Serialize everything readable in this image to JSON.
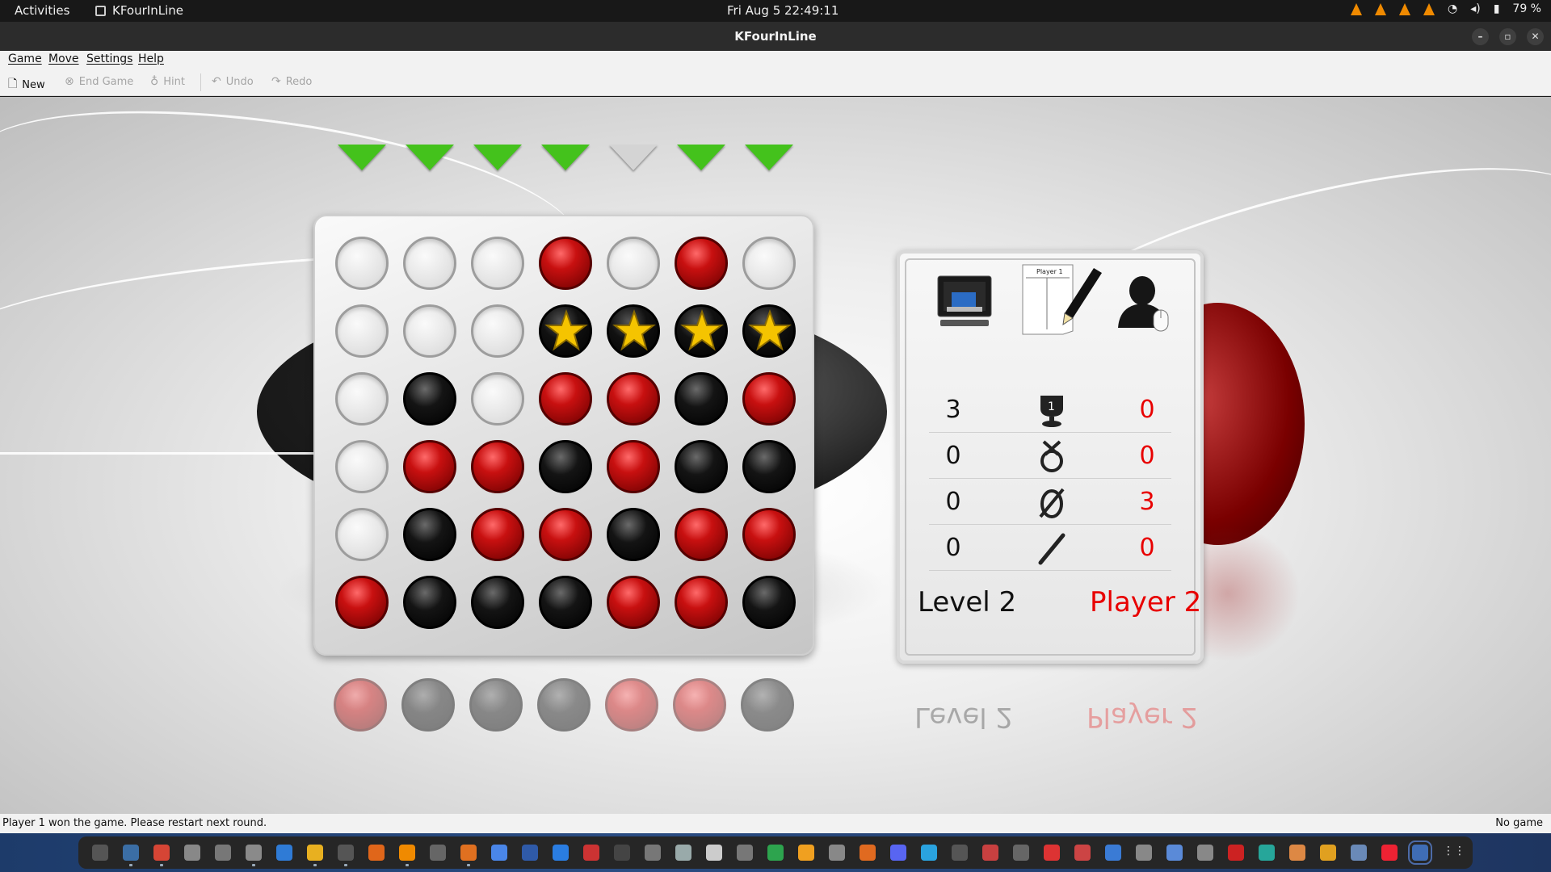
{
  "topbar": {
    "activities": "Activities",
    "app_name": "KFourInLine",
    "clock": "Fri Aug 5  22:49:11",
    "battery": "79 %"
  },
  "window": {
    "title": "KFourInLine"
  },
  "menu": {
    "game": "Game",
    "move": "Move",
    "settings": "Settings",
    "help": "Help"
  },
  "toolbar": {
    "new": "New",
    "end_game": "End Game",
    "hint": "Hint",
    "undo": "Undo",
    "redo": "Redo"
  },
  "board": {
    "columns": 7,
    "rows": 6,
    "column_arrows": [
      "green",
      "green",
      "green",
      "green",
      "grey",
      "green",
      "green"
    ],
    "cells": [
      [
        "empty",
        "empty",
        "empty",
        "red",
        "empty",
        "red",
        "empty"
      ],
      [
        "empty",
        "empty",
        "empty",
        "star",
        "star",
        "star",
        "star"
      ],
      [
        "empty",
        "black",
        "empty",
        "red",
        "red",
        "black",
        "red"
      ],
      [
        "empty",
        "red",
        "red",
        "black",
        "red",
        "black",
        "black"
      ],
      [
        "empty",
        "black",
        "red",
        "red",
        "black",
        "red",
        "red"
      ],
      [
        "red",
        "black",
        "black",
        "black",
        "red",
        "red",
        "black"
      ]
    ]
  },
  "scoreboard": {
    "header_sheet_label": "Player 1",
    "rows": [
      {
        "left": "3",
        "icon": "trophy-icon",
        "right": "0"
      },
      {
        "left": "0",
        "icon": "loss-icon",
        "right": "0"
      },
      {
        "left": "0",
        "icon": "draw-icon",
        "right": "3"
      },
      {
        "left": "0",
        "icon": "brake-icon",
        "right": "0"
      }
    ],
    "left_player": "Level 2",
    "right_player": "Player 2",
    "colors": {
      "left": "#111111",
      "right": "#e80000"
    }
  },
  "status": {
    "message": "Player 1 won the game. Please restart next round.",
    "state": "No game"
  },
  "colors": {
    "arrow_active": "#44c21c",
    "arrow_inactive": "#d4d4d4",
    "piece_red": "#c81010",
    "piece_black": "#141414",
    "star": "#f5c400"
  }
}
